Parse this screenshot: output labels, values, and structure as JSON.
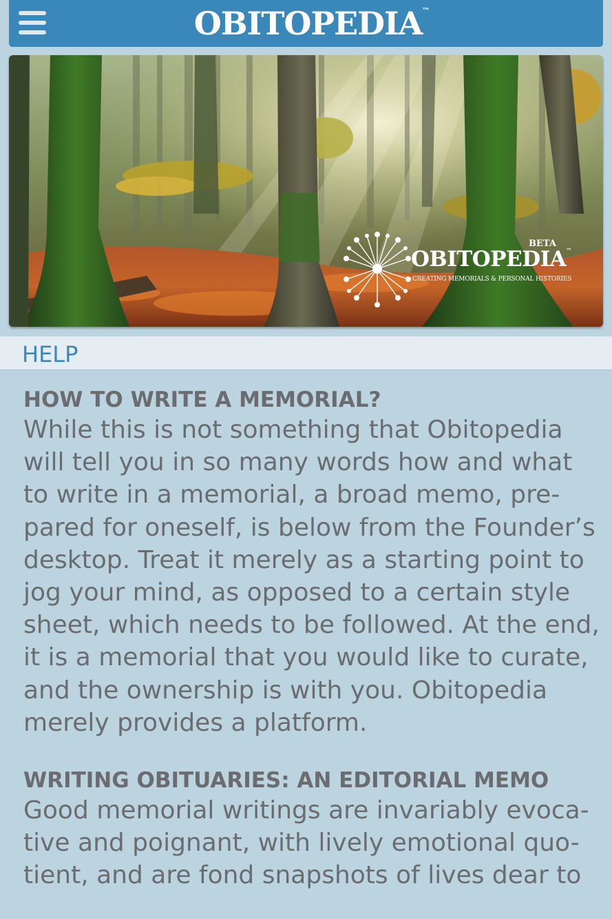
{
  "header": {
    "menu_icon": "hamburger-menu-icon",
    "brand": "OBITOPEDIA",
    "brand_tm": "™"
  },
  "hero": {
    "image": "autumn-forest-banner",
    "logo_beta": "BETA",
    "logo_brand": "OBITOPEDIA",
    "logo_tm": "™",
    "logo_tagline": "CREATING MEMORIALS & PERSONAL HISTORIES",
    "logo_icon": "dandelion-icon"
  },
  "help_bar": {
    "label": "HELP"
  },
  "sections": [
    {
      "title": "HOW TO WRITE A MEMORIAL?",
      "lines": [
        "While this is not something that Obitopedia",
        "will tell you in so many words how and what",
        "to write in a memorial, a broad memo, pre-",
        "pared for oneself, is below from the Founder’s",
        "desktop. Treat it merely as a starting point to",
        "jog your mind, as opposed to a certain style",
        "sheet, which needs to be followed. At the end,",
        "it is a memorial that you would like to curate,",
        "and the ownership is with you. Obitopedia",
        "merely provides a platform."
      ]
    },
    {
      "title": "WRITING OBITUARIES: AN EDITORIAL MEMO",
      "lines": [
        "Good memorial writings are invariably evoca-",
        "tive and poignant, with lively emotional quo-",
        "tient, and are fond snapshots of lives dear to"
      ]
    }
  ],
  "colors": {
    "header_bg": "#3a87ba",
    "page_bg": "#bcd4e0",
    "help_bar_bg": "#e5edf2",
    "accent_text": "#3a87ba",
    "body_text": "#6a6c70"
  }
}
